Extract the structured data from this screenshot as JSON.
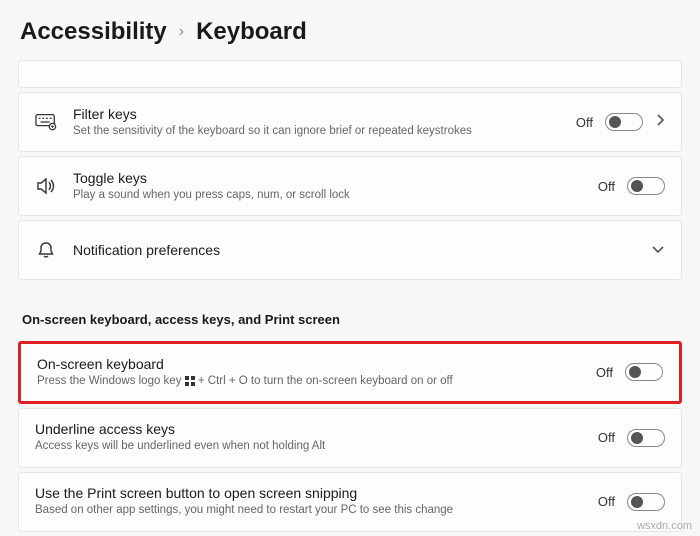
{
  "header": {
    "parent": "Accessibility",
    "separator": "›",
    "current": "Keyboard"
  },
  "cards": {
    "filter_keys": {
      "title": "Filter keys",
      "desc": "Set the sensitivity of the keyboard so it can ignore brief or repeated keystrokes",
      "state": "Off"
    },
    "toggle_keys": {
      "title": "Toggle keys",
      "desc": "Play a sound when you press caps, num, or scroll lock",
      "state": "Off"
    },
    "notification": {
      "title": "Notification preferences"
    }
  },
  "section_heading": "On-screen keyboard, access keys, and Print screen",
  "osk": {
    "title": "On-screen keyboard",
    "desc_pre": "Press the Windows logo key ",
    "desc_post": " + Ctrl + O to turn the on-screen keyboard on or off",
    "state": "Off"
  },
  "underline": {
    "title": "Underline access keys",
    "desc": "Access keys will be underlined even when not holding Alt",
    "state": "Off"
  },
  "printscreen": {
    "title": "Use the Print screen button to open screen snipping",
    "desc": "Based on other app settings, you might need to restart your PC to see this change",
    "state": "Off"
  },
  "watermark": "wsxdn.com"
}
